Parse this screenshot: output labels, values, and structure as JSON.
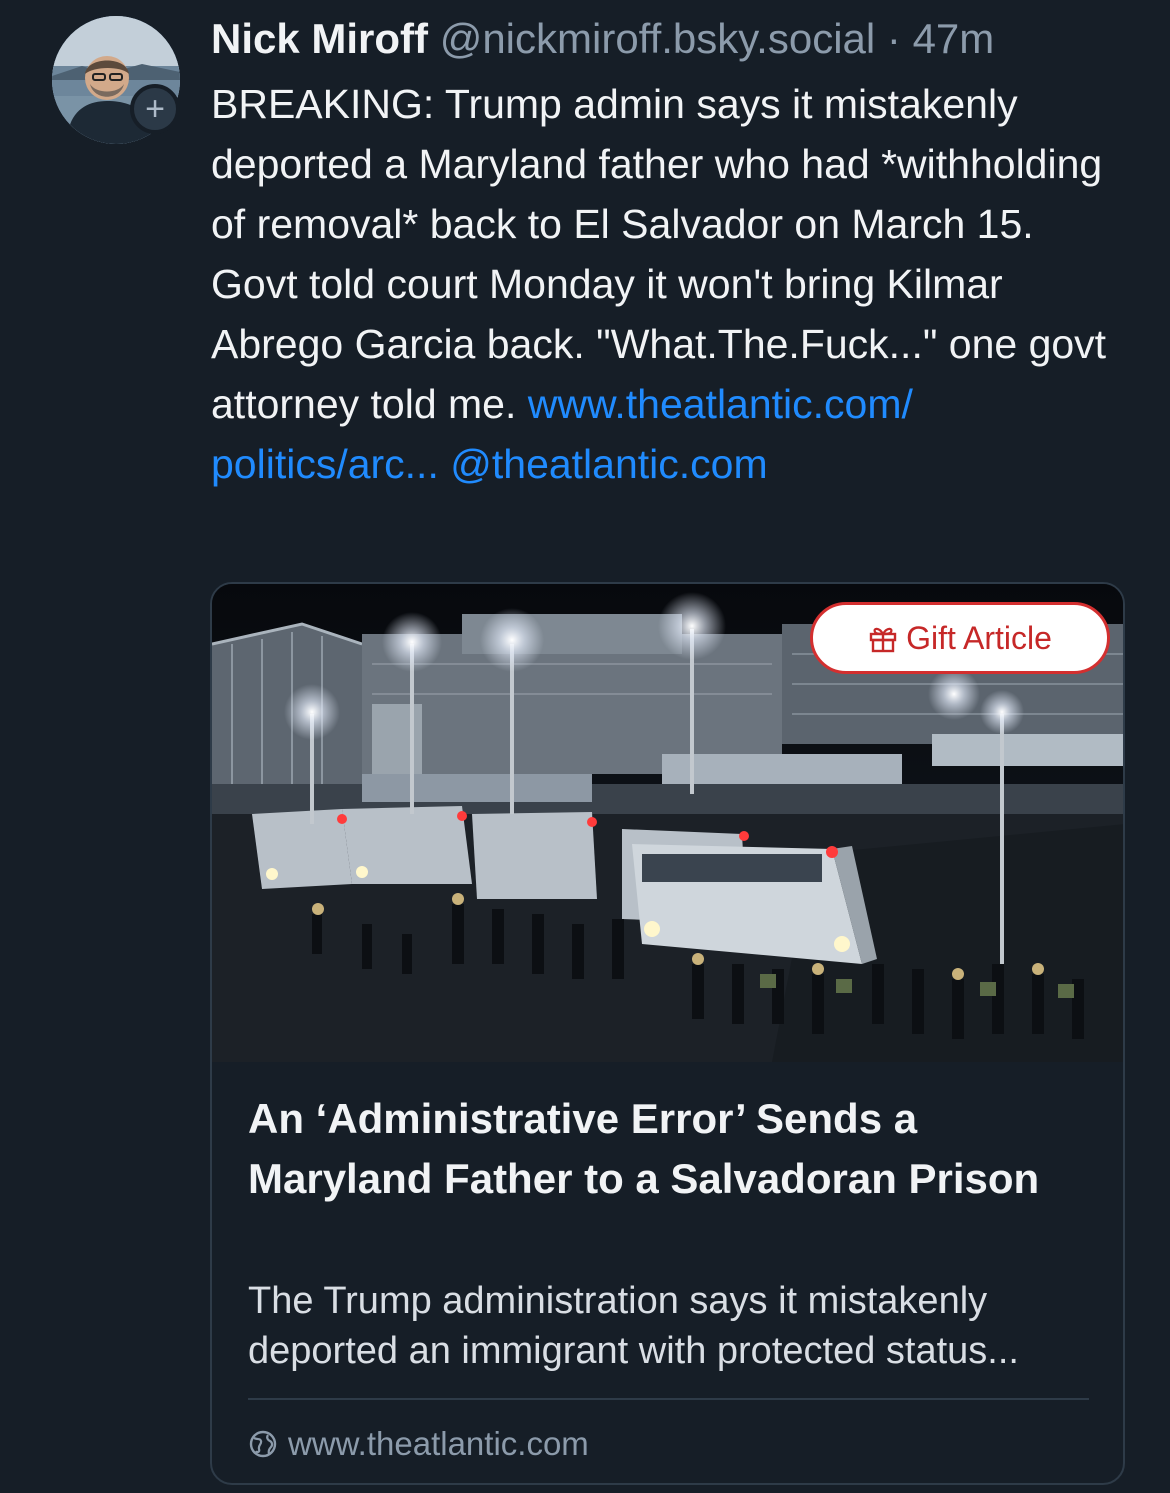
{
  "post": {
    "author": {
      "display_name": "Nick Miroff",
      "handle": "@nickmiroff.bsky.social",
      "separator": "·",
      "time": "47m"
    },
    "follow_icon": "plus-icon",
    "follow_label": "+",
    "text_plain": "BREAKING: Trump admin says it mistakenly deported a Maryland father who had *withholding of removal* back to El Salvador on March 15. Govt told court Monday it won't bring Kilmar Abrego Garcia back. \"What.The.Fuck...\" one govt attorney told me.",
    "link_text": "www.theatlantic.com/ politics/arc...",
    "mention_text": "@theatlantic.com"
  },
  "card": {
    "image_description": "",
    "gift_label": "Gift Article",
    "gift_icon": "gift-icon",
    "title": "An ‘Administrative Error’ Sends a Maryland Father to a Salvadoran Prison",
    "description": "The Trump administration says it mistakenly deported an immigrant with protected status...",
    "domain_icon": "globe-icon",
    "domain": "www.theatlantic.com"
  },
  "colors": {
    "background": "#161e27",
    "link": "#208bfe",
    "muted": "#8c9bab",
    "gift_border": "#d32f2f"
  }
}
